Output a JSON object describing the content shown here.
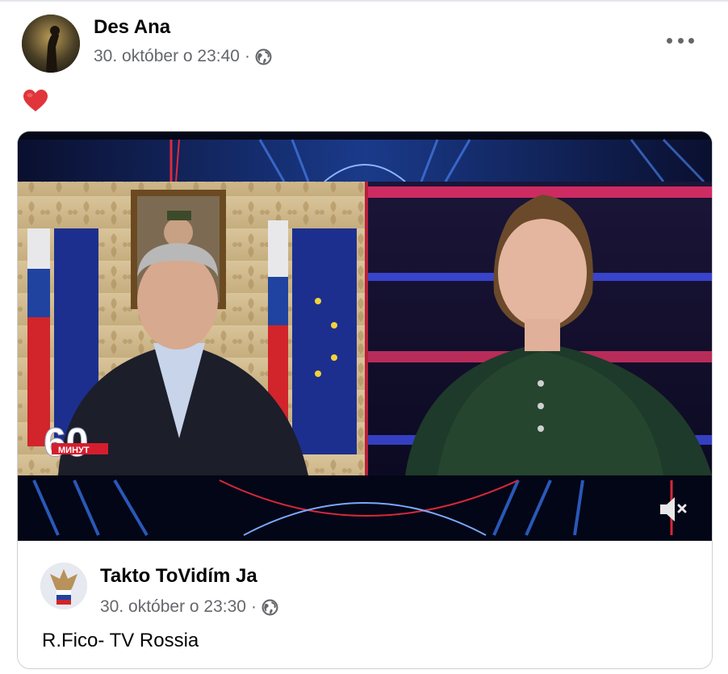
{
  "post": {
    "author": "Des Ana",
    "timestamp": "30. október o 23:40",
    "separator": "·",
    "privacy_icon": "globe-icon",
    "more_icon": "more-options-icon",
    "emoji": "red-heart-emoji"
  },
  "shared_post": {
    "author": "Takto ToVidím Ja",
    "timestamp": "30. október o 23:30",
    "separator": "·",
    "privacy_icon": "globe-icon",
    "text": "R.Fico- TV Rossia",
    "video": {
      "logo_text": "60",
      "logo_subtext": "МИНУТ",
      "mute_icon": "speaker-muted-icon"
    }
  },
  "colors": {
    "text_primary": "#050505",
    "text_secondary": "#65676b",
    "border": "#ced0d4",
    "heart": "#e0353a"
  }
}
